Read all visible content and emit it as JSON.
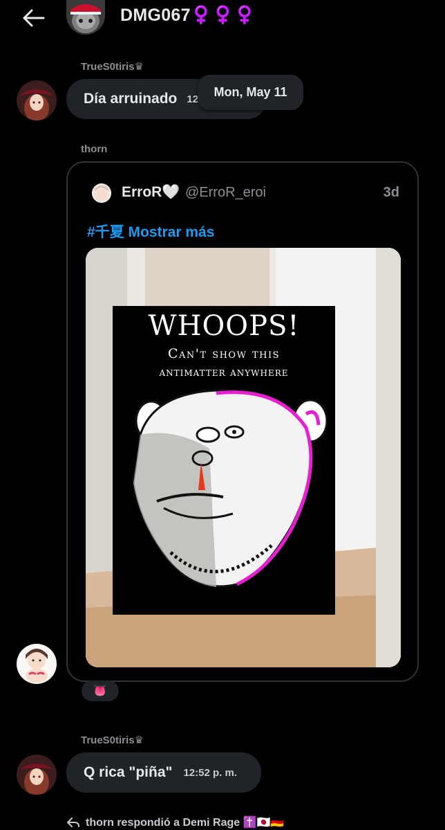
{
  "header": {
    "back_label": "←",
    "name": "DMG067♀️♀️♀️"
  },
  "messages": [
    {
      "sender": "TrueS0tiris♛",
      "text": "Día arruinado",
      "time": "12:51 p. m."
    },
    {
      "sender": "TrueS0tiris♛",
      "text": "Q rica \"piña\"",
      "time": "12:52 p. m."
    }
  ],
  "date_tooltip": "Mon, May 11",
  "shared_post": {
    "sender": "thorn",
    "author_name": "ErroR🤍",
    "author_handle": "@ErroR_eroi",
    "age": "3d",
    "text": "#千夏 Mostrar más",
    "media_overlay": {
      "title": "WHOOPS!",
      "line1": "Can't show this",
      "line2": "antimatter anywhere"
    }
  },
  "reaction": "👅",
  "footer": {
    "reply_text": "thorn respondió a Demi Rage ✝️🇯🇵🇩🇪"
  },
  "colors": {
    "background": "#000000",
    "bubble": "#202327",
    "muted": "#8b8f94",
    "link": "#1d9bf0"
  }
}
